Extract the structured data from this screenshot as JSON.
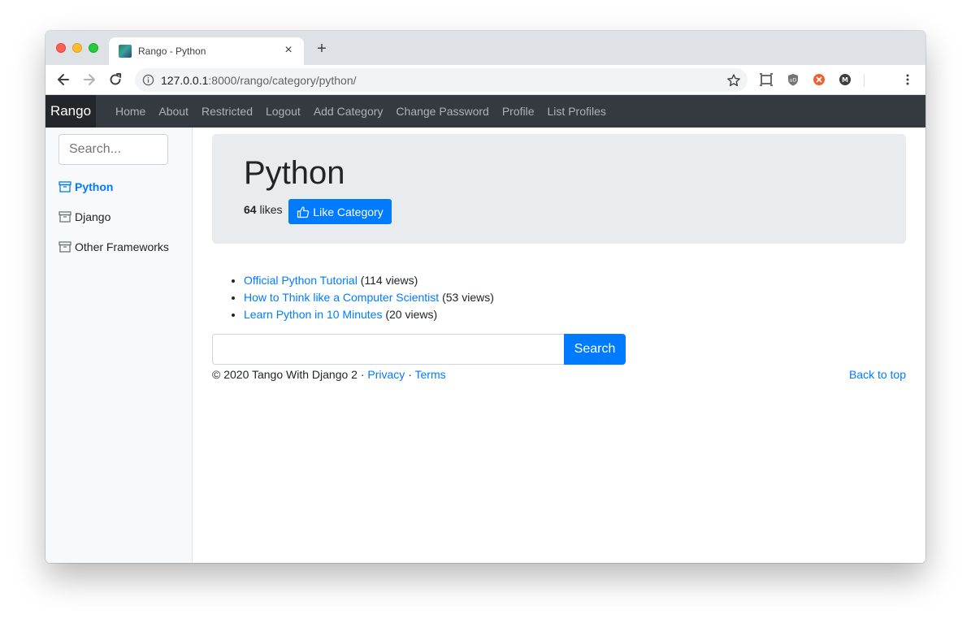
{
  "browser": {
    "tab_title": "Rango - Python",
    "new_tab": "+",
    "tab_close": "×",
    "url_host": "127.0.0.1",
    "url_rest": ":8000/rango/category/python/"
  },
  "navbar": {
    "brand": "Rango",
    "links": [
      "Home",
      "About",
      "Restricted",
      "Logout",
      "Add Category",
      "Change Password",
      "Profile",
      "List Profiles"
    ]
  },
  "sidebar": {
    "search_placeholder": "Search...",
    "items": [
      {
        "label": "Python",
        "active": true
      },
      {
        "label": "Django",
        "active": false
      },
      {
        "label": "Other Frameworks",
        "active": false
      }
    ]
  },
  "category": {
    "title": "Python",
    "likes": "64",
    "likes_suffix": "likes",
    "like_button": "Like Category"
  },
  "pages": [
    {
      "title": "Official Python Tutorial",
      "views": "(114 views)"
    },
    {
      "title": "How to Think like a Computer Scientist",
      "views": "(53 views)"
    },
    {
      "title": "Learn Python in 10 Minutes",
      "views": "(20 views)"
    }
  ],
  "search": {
    "button": "Search"
  },
  "footer": {
    "copyright": "© 2020 Tango With Django 2 · ",
    "privacy": "Privacy",
    "separator": " · ",
    "terms": "Terms",
    "back_to_top": "Back to top"
  },
  "colors": {
    "accent": "#007bff",
    "navbar": "#343a40",
    "jumbotron": "#e9ecef"
  }
}
